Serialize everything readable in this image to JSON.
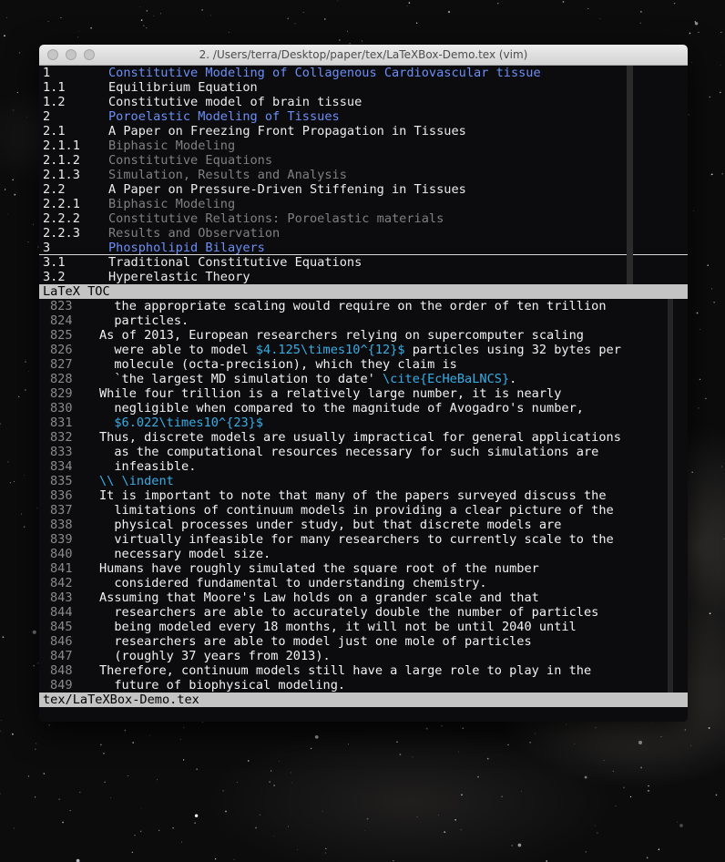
{
  "window": {
    "title": "2. /Users/terra/Desktop/paper/tex/LaTeXBox-Demo.tex (vim)"
  },
  "toc": {
    "items": [
      {
        "num": "1",
        "text": "Constitutive Modeling of Collagenous Cardiovascular tissue",
        "level": "chapter"
      },
      {
        "num": "1.1",
        "text": "Equilibrium Equation",
        "level": "section"
      },
      {
        "num": "1.2",
        "text": "Constitutive model of brain tissue",
        "level": "section"
      },
      {
        "num": "2",
        "text": "Poroelastic Modeling of Tissues",
        "level": "chapter"
      },
      {
        "num": "2.1",
        "text": "A Paper on Freezing Front Propagation in Tissues",
        "level": "section"
      },
      {
        "num": "2.1.1",
        "text": "Biphasic Modeling",
        "level": "subsection"
      },
      {
        "num": "2.1.2",
        "text": "Constitutive Equations",
        "level": "subsection"
      },
      {
        "num": "2.1.3",
        "text": "Simulation, Results and Analysis",
        "level": "subsection"
      },
      {
        "num": "2.2",
        "text": "A Paper on Pressure-Driven Stiffening in Tissues",
        "level": "section"
      },
      {
        "num": "2.2.1",
        "text": "Biphasic Modeling",
        "level": "subsection"
      },
      {
        "num": "2.2.2",
        "text": "Constitutive Relations: Poroelastic materials",
        "level": "subsection"
      },
      {
        "num": "2.2.3",
        "text": "Results and Observation",
        "level": "subsection"
      },
      {
        "num": "3",
        "text": "Phospholipid Bilayers",
        "level": "chapter"
      },
      {
        "num": "3.1",
        "text": "Traditional Constitutive Equations",
        "level": "section"
      },
      {
        "num": "3.2",
        "text": "Hyperelastic Theory",
        "level": "section"
      }
    ],
    "cursor_index": 12,
    "status_label": "LaTeX TOC"
  },
  "editor": {
    "lines": [
      {
        "n": "823",
        "segments": [
          {
            "t": "  the appropriate scaling would require on the order of ten trillion",
            "k": "text"
          }
        ]
      },
      {
        "n": "824",
        "segments": [
          {
            "t": "  particles.",
            "k": "text"
          }
        ]
      },
      {
        "n": "825",
        "segments": [
          {
            "t": "As of 2013, European researchers relying on supercomputer scaling",
            "k": "text"
          }
        ]
      },
      {
        "n": "826",
        "segments": [
          {
            "t": "  were able to model ",
            "k": "text"
          },
          {
            "t": "$4.125\\times10^{12}$",
            "k": "math"
          },
          {
            "t": " particles using 32 bytes per",
            "k": "text"
          }
        ]
      },
      {
        "n": "827",
        "segments": [
          {
            "t": "  molecule (octa-precision), which they claim is",
            "k": "text"
          }
        ]
      },
      {
        "n": "828",
        "segments": [
          {
            "t": "  `the largest MD simulation to date' ",
            "k": "text"
          },
          {
            "t": "\\cite{EcHeBaLNCS}",
            "k": "cmd"
          },
          {
            "t": ".",
            "k": "text"
          }
        ]
      },
      {
        "n": "829",
        "segments": [
          {
            "t": "While four trillion is a relatively large number, it is nearly",
            "k": "text"
          }
        ]
      },
      {
        "n": "830",
        "segments": [
          {
            "t": "  negligible when compared to the magnitude of Avogadro's number,",
            "k": "text"
          }
        ]
      },
      {
        "n": "831",
        "segments": [
          {
            "t": "  ",
            "k": "text"
          },
          {
            "t": "$6.022\\times10^{23}$",
            "k": "math"
          }
        ]
      },
      {
        "n": "832",
        "segments": [
          {
            "t": "Thus, discrete models are usually impractical for general applications",
            "k": "text"
          }
        ]
      },
      {
        "n": "833",
        "segments": [
          {
            "t": "  as the computational resources necessary for such simulations are",
            "k": "text"
          }
        ]
      },
      {
        "n": "834",
        "segments": [
          {
            "t": "  infeasible.",
            "k": "text"
          }
        ]
      },
      {
        "n": "835",
        "segments": [
          {
            "t": "\\\\ \\indent",
            "k": "cmd"
          }
        ]
      },
      {
        "n": "836",
        "segments": [
          {
            "t": "It is important to note that many of the papers surveyed discuss the",
            "k": "text"
          }
        ]
      },
      {
        "n": "837",
        "segments": [
          {
            "t": "  limitations of continuum models in providing a clear picture of the",
            "k": "text"
          }
        ]
      },
      {
        "n": "838",
        "segments": [
          {
            "t": "  physical processes under study, but that discrete models are",
            "k": "text"
          }
        ]
      },
      {
        "n": "839",
        "segments": [
          {
            "t": "  virtually infeasible for many researchers to currently scale to the",
            "k": "text"
          }
        ]
      },
      {
        "n": "840",
        "segments": [
          {
            "t": "  necessary model size.",
            "k": "text"
          }
        ]
      },
      {
        "n": "841",
        "segments": [
          {
            "t": "Humans have roughly simulated the square root of the number",
            "k": "text"
          }
        ]
      },
      {
        "n": "842",
        "segments": [
          {
            "t": "  considered fundamental to understanding chemistry.",
            "k": "text"
          }
        ]
      },
      {
        "n": "843",
        "segments": [
          {
            "t": "Assuming that Moore's Law holds on a grander scale and that",
            "k": "text"
          }
        ]
      },
      {
        "n": "844",
        "segments": [
          {
            "t": "  researchers are able to accurately double the number of particles",
            "k": "text"
          }
        ]
      },
      {
        "n": "845",
        "segments": [
          {
            "t": "  being modeled every 18 months, it will not be until 2040 until",
            "k": "text"
          }
        ]
      },
      {
        "n": "846",
        "segments": [
          {
            "t": "  researchers are able to model just one mole of particles",
            "k": "text"
          }
        ]
      },
      {
        "n": "847",
        "segments": [
          {
            "t": "  (roughly 37 years from 2013).",
            "k": "text"
          }
        ]
      },
      {
        "n": "848",
        "segments": [
          {
            "t": "Therefore, continuum models still have a large role to play in the",
            "k": "text"
          }
        ]
      },
      {
        "n": "849",
        "segments": [
          {
            "t": "  future of biophysical modeling.",
            "k": "text"
          }
        ]
      }
    ],
    "status_label": "tex/LaTeXBox-Demo.tex"
  },
  "colors": {
    "chapter": "#6b8ff7",
    "subsection": "#808080",
    "section": "#ececec",
    "math": "#35aee6",
    "cmd": "#35aee6",
    "status_bar": "#c4c4c4"
  }
}
